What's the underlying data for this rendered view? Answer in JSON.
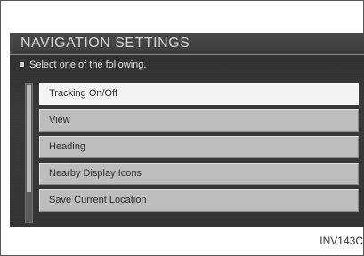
{
  "screen": {
    "title": "NAVIGATION SETTINGS",
    "prompt": "Select one of the following."
  },
  "menu": {
    "items": [
      {
        "label": "Tracking On/Off",
        "selected": true
      },
      {
        "label": "View",
        "selected": false
      },
      {
        "label": "Heading",
        "selected": false
      },
      {
        "label": "Nearby Display Icons",
        "selected": false
      },
      {
        "label": "Save Current Location",
        "selected": false
      }
    ]
  },
  "figure_code": "INV143C"
}
